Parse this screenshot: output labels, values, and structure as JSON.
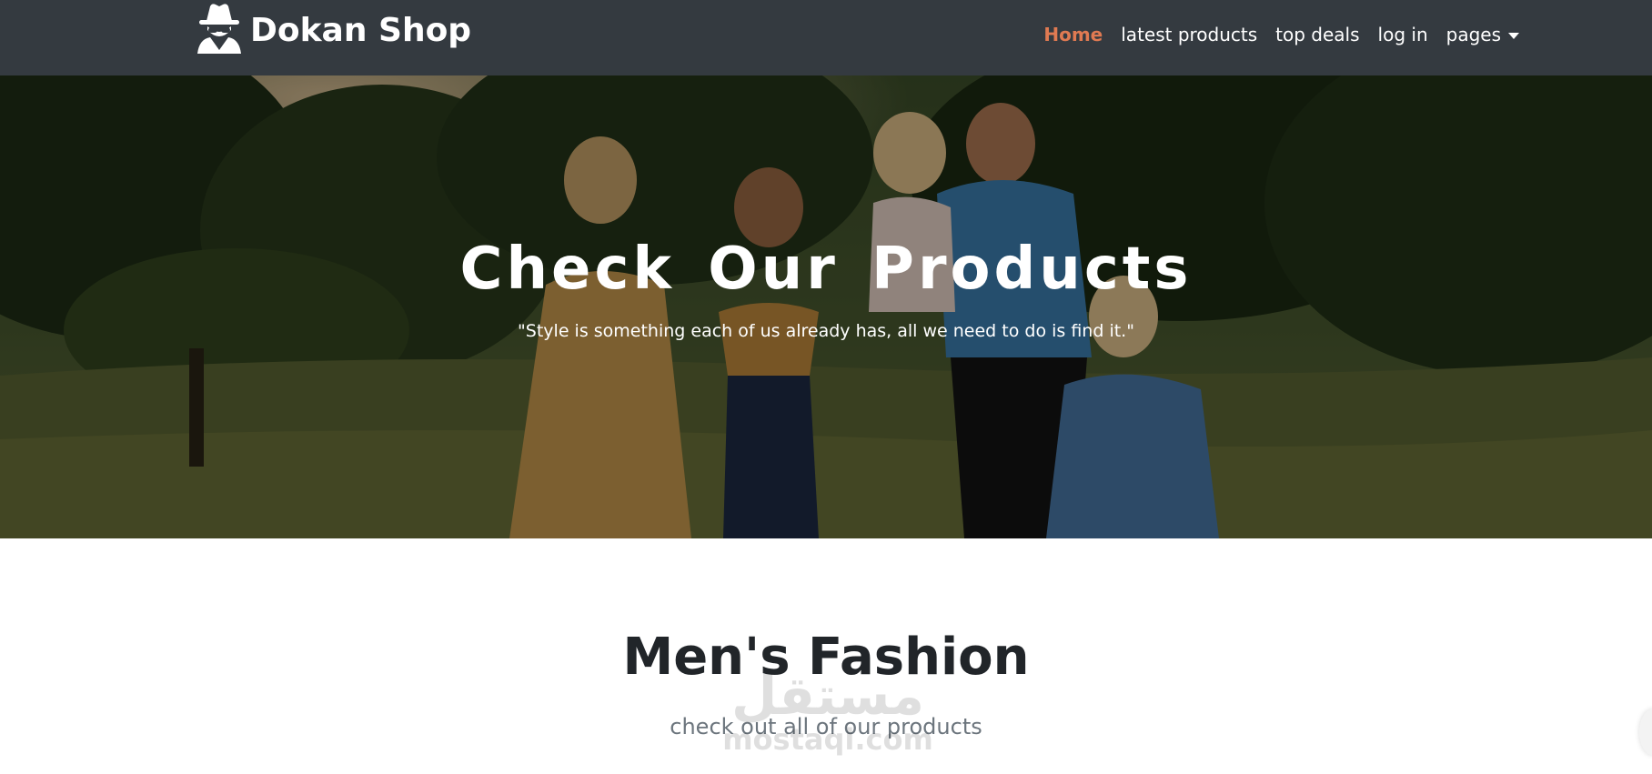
{
  "brand": {
    "name": "Dokan Shop",
    "logo_icon": "spy-icon"
  },
  "nav": {
    "items": [
      {
        "label": "Home",
        "active": true
      },
      {
        "label": "latest products",
        "active": false
      },
      {
        "label": "top deals",
        "active": false
      },
      {
        "label": "log in",
        "active": false
      },
      {
        "label": "pages",
        "active": false,
        "dropdown": true
      }
    ]
  },
  "hero": {
    "title": "Check Our Products",
    "quote": "\"Style is something each of us already has, all we need to do is find it.\""
  },
  "section": {
    "title": "Men's Fashion",
    "subtitle": "check out all of our products"
  },
  "watermark": {
    "arabic": "مستقل",
    "latin": "mostaql.com"
  },
  "colors": {
    "navbar": "#343a40",
    "active_link": "#e07a52",
    "heading": "#212529",
    "muted": "#6c757d"
  }
}
